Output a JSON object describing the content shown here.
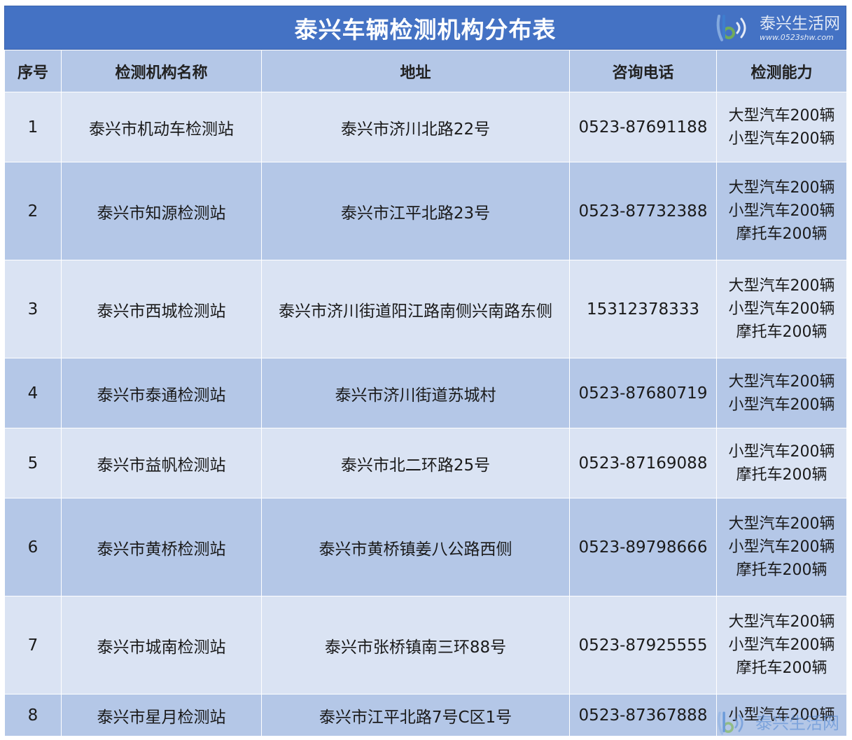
{
  "title": "泰兴车辆检测机构分布表",
  "watermark": {
    "brand": "泰兴生活网",
    "url": "www.0523shw.com",
    "logo_icon": "signal-logo-icon"
  },
  "headers": [
    "序号",
    "检测机构名称",
    "地址",
    "咨询电话",
    "检测能力"
  ],
  "rows": [
    {
      "no": "1",
      "name": "泰兴市机动车检测站",
      "address": "泰兴市济川北路22号",
      "phone": "0523-87691188",
      "capability": [
        "大型汽车200辆",
        "小型汽车200辆"
      ]
    },
    {
      "no": "2",
      "name": "泰兴市知源检测站",
      "address": "泰兴市江平北路23号",
      "phone": "0523-87732388",
      "capability": [
        "大型汽车200辆",
        "小型汽车200辆",
        "摩托车200辆"
      ]
    },
    {
      "no": "3",
      "name": "泰兴市西城检测站",
      "address": "泰兴市济川街道阳江路南侧兴南路东侧",
      "phone": "15312378333",
      "capability": [
        "大型汽车200辆",
        "小型汽车200辆",
        "摩托车200辆"
      ]
    },
    {
      "no": "4",
      "name": "泰兴市泰通检测站",
      "address": "泰兴市济川街道苏城村",
      "phone": "0523-87680719",
      "capability": [
        "大型汽车200辆",
        "小型汽车200辆"
      ]
    },
    {
      "no": "5",
      "name": "泰兴市益帆检测站",
      "address": "泰兴市北二环路25号",
      "phone": "0523-87169088",
      "capability": [
        "小型汽车200辆",
        "摩托车200辆"
      ]
    },
    {
      "no": "6",
      "name": "泰兴市黄桥检测站",
      "address": "泰兴市黄桥镇姜八公路西侧",
      "phone": "0523-89798666",
      "capability": [
        "大型汽车200辆",
        "小型汽车200辆",
        "摩托车200辆"
      ]
    },
    {
      "no": "7",
      "name": "泰兴市城南检测站",
      "address": "泰兴市张桥镇南三环88号",
      "phone": "0523-87925555",
      "capability": [
        "大型汽车200辆",
        "小型汽车200辆",
        "摩托车200辆"
      ]
    },
    {
      "no": "8",
      "name": "泰兴市星月检测站",
      "address": "泰兴市江平北路7号C区1号",
      "phone": "0523-87367888",
      "capability": [
        "小型汽车200辆"
      ]
    }
  ],
  "colors": {
    "title_bg": "#4472c4",
    "header_bg": "#b4c7e7",
    "row_light": "#dae3f3",
    "row_dark": "#b4c7e7"
  }
}
